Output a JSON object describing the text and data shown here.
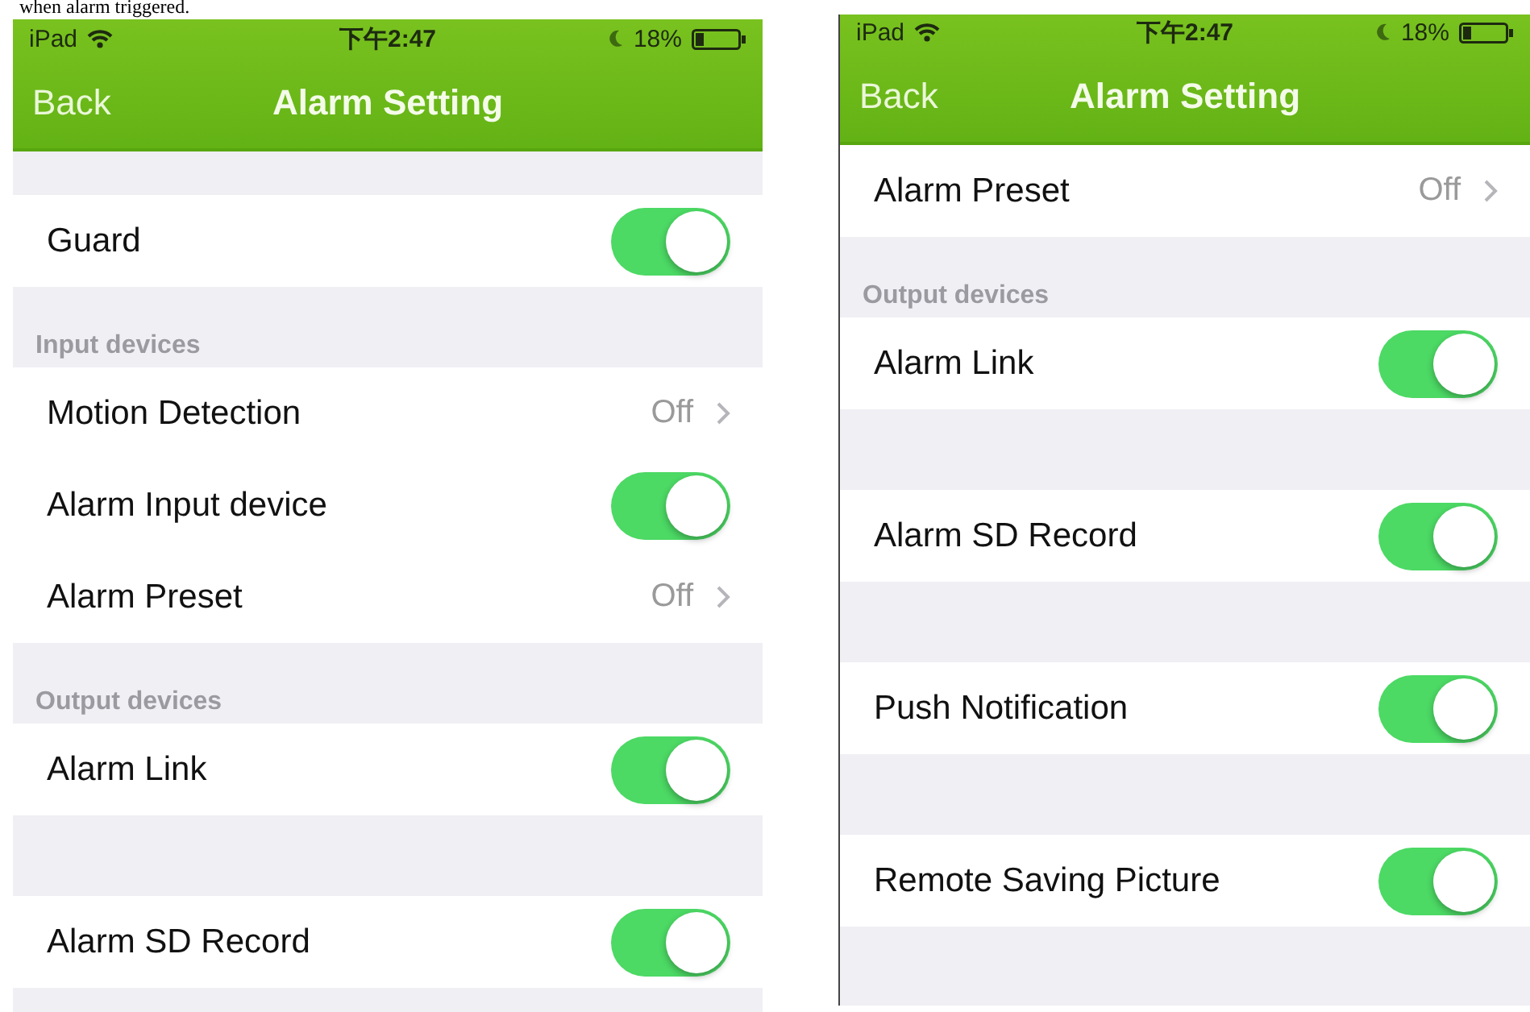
{
  "caption": "when alarm triggered.",
  "screens": [
    {
      "status": {
        "carrier": "iPad",
        "time": "下午2:47",
        "battery": "18%"
      },
      "nav": {
        "back": "Back",
        "title": "Alarm Setting"
      },
      "scrolled": false,
      "sections": [
        {
          "items": [
            {
              "kind": "toggle",
              "label": "Guard",
              "on": true
            }
          ]
        },
        {
          "header": "Input devices",
          "items": [
            {
              "kind": "link",
              "label": "Motion Detection",
              "value": "Off"
            },
            {
              "kind": "toggle",
              "label": "Alarm Input device",
              "on": true
            },
            {
              "kind": "link",
              "label": "Alarm Preset",
              "value": "Off"
            }
          ]
        },
        {
          "header": "Output devices",
          "items": [
            {
              "kind": "toggle",
              "label": "Alarm Link",
              "on": true
            }
          ]
        },
        {
          "items": [
            {
              "kind": "toggle",
              "label": "Alarm SD Record",
              "on": true
            }
          ]
        }
      ]
    },
    {
      "status": {
        "carrier": "iPad",
        "time": "下午2:47",
        "battery": "18%"
      },
      "nav": {
        "back": "Back",
        "title": "Alarm Setting"
      },
      "scrolled": true,
      "sections": [
        {
          "items": [
            {
              "kind": "link",
              "label": "Alarm Preset",
              "value": "Off"
            }
          ]
        },
        {
          "header": "Output devices",
          "items": [
            {
              "kind": "toggle",
              "label": "Alarm Link",
              "on": true
            }
          ]
        },
        {
          "items": [
            {
              "kind": "toggle",
              "label": "Alarm SD Record",
              "on": true
            }
          ]
        },
        {
          "items": [
            {
              "kind": "toggle",
              "label": "Push Notification",
              "on": true
            }
          ]
        },
        {
          "items": [
            {
              "kind": "toggle",
              "label": "Remote Saving Picture",
              "on": true
            }
          ]
        }
      ]
    }
  ]
}
